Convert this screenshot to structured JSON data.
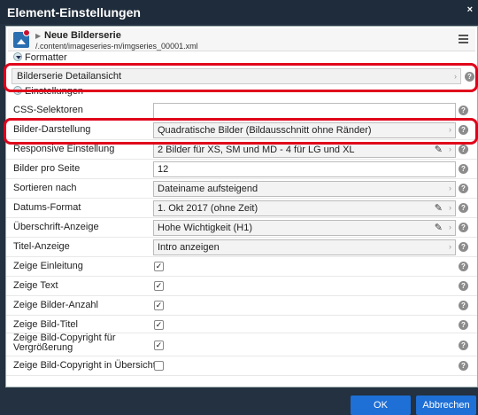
{
  "dialog": {
    "title": "Element-Einstellungen",
    "close": "×"
  },
  "resource": {
    "title": "Neue Bilderserie",
    "path": "/.content/imageseries-m/imgseries_00001.xml"
  },
  "formatter": {
    "section_label": "Formatter",
    "value": "Bilderserie Detailansicht"
  },
  "settings": {
    "section_label": "Einstellungen",
    "rows": [
      {
        "label": "CSS-Selektoren",
        "type": "input",
        "value": ""
      },
      {
        "label": "Bilder-Darstellung",
        "type": "select",
        "value": "Quadratische Bilder (Bildausschnitt ohne Ränder)"
      },
      {
        "label": "Responsive Einstellung",
        "type": "select-edit",
        "value": "2 Bilder für XS, SM und MD - 4 für LG und XL"
      },
      {
        "label": "Bilder pro Seite",
        "type": "input",
        "value": "12"
      },
      {
        "label": "Sortieren nach",
        "type": "select",
        "value": "Dateiname aufsteigend"
      },
      {
        "label": "Datums-Format",
        "type": "select-edit",
        "value": "1. Okt 2017 (ohne Zeit)"
      },
      {
        "label": "Überschrift-Anzeige",
        "type": "select-edit",
        "value": "Hohe Wichtigkeit (H1)"
      },
      {
        "label": "Titel-Anzeige",
        "type": "select",
        "value": "Intro anzeigen"
      },
      {
        "label": "Zeige Einleitung",
        "type": "checkbox",
        "checked": true
      },
      {
        "label": "Zeige Text",
        "type": "checkbox",
        "checked": true
      },
      {
        "label": "Zeige Bilder-Anzahl",
        "type": "checkbox",
        "checked": true
      },
      {
        "label": "Zeige Bild-Titel",
        "type": "checkbox",
        "checked": true
      },
      {
        "label": "Zeige Bild-Copyright für\nVergrößerung",
        "type": "checkbox",
        "checked": true
      },
      {
        "label": "Zeige Bild-Copyright in Übersicht",
        "type": "checkbox",
        "checked": false
      }
    ]
  },
  "buttons": {
    "ok": "OK",
    "cancel": "Abbrechen"
  },
  "colors": {
    "highlight": "#e0001a",
    "primary_button": "#1e6fd6",
    "titlebar": "#1f2c3b"
  },
  "icons": {
    "help": "question-circle-icon",
    "edit": "pencil-icon",
    "menu": "hamburger-icon"
  }
}
